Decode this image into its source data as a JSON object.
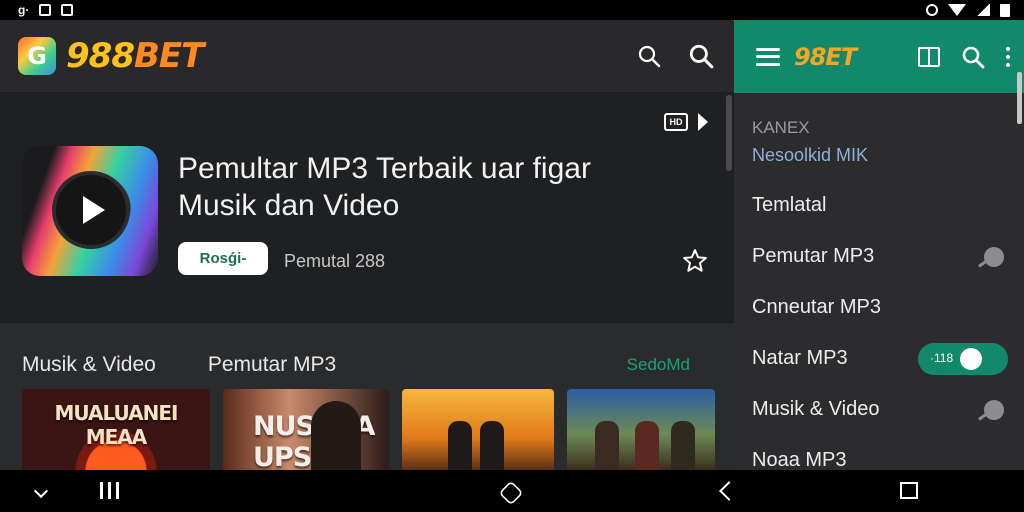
{
  "status_bar": {
    "left_text": "g·"
  },
  "header": {
    "logo_mark": "G",
    "logo_digits": "988",
    "logo_word": "BET",
    "icons": [
      "search-icon",
      "search-icon"
    ]
  },
  "hero": {
    "cast_label": "HD",
    "title_line1": "Pemultar MP3 Terbaik uar figar",
    "title_line2": "Musik dan Video",
    "install_label": "Rosǵi-",
    "meta": "Pemutal 288"
  },
  "sections": {
    "tab1": "Musik & Video",
    "tab2": "Pemutar MP3",
    "see_more": "SedoMd"
  },
  "thumbnails": [
    {
      "caption": "MUALUANEI MEAA"
    },
    {
      "caption": "NUSLITA UPS"
    },
    {
      "caption": ""
    },
    {
      "caption": ""
    }
  ],
  "drawer": {
    "logo": "98ET",
    "sub1": "KANEX",
    "sub2": "Nesoolkid MIK",
    "items": [
      {
        "label": "Temlatal"
      },
      {
        "label": "Pemutar MP3"
      },
      {
        "label": "Cnneutar MP3"
      },
      {
        "label": "Natar MP3",
        "toggle_text": "·118"
      },
      {
        "label": "Musik & Video"
      },
      {
        "label": "Noaa MP3"
      }
    ]
  },
  "colors": {
    "accent": "#12896a",
    "link": "#19a46f",
    "background": "#2a2b2d",
    "hero_background": "#1f2022",
    "logo_yellow": "#ffc21a"
  }
}
